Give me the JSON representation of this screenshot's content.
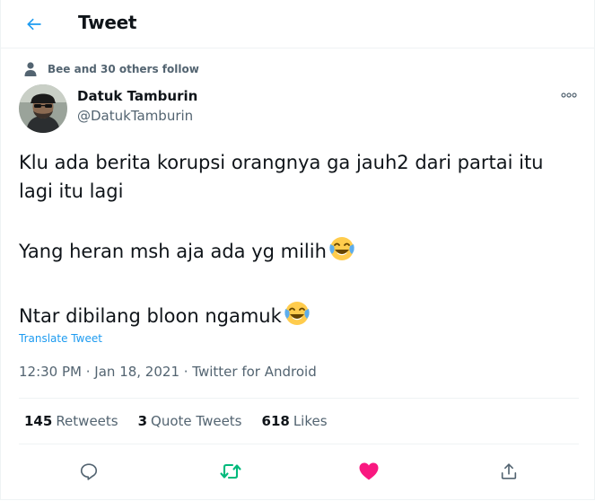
{
  "header": {
    "title": "Tweet"
  },
  "social_context": {
    "text": "Bee and 30 others follow"
  },
  "author": {
    "display_name": "Datuk Tamburin",
    "username": "@DatukTamburin"
  },
  "tweet": {
    "lines": [
      "Klu ada berita korupsi orangnya ga jauh2 dari partai itu lagi itu lagi",
      "Yang heran msh aja ada yg milih",
      "Ntar dibilang bloon ngamuk"
    ],
    "emoji": "face-with-tears-of-joy"
  },
  "translate_label": "Translate Tweet",
  "meta": {
    "time": "12:30 PM",
    "date": "Jan 18, 2021",
    "separator": " · ",
    "source": "Twitter for Android"
  },
  "stats": {
    "retweets": {
      "count": "145",
      "label": "Retweets"
    },
    "quotes": {
      "count": "3",
      "label": "Quote Tweets"
    },
    "likes": {
      "count": "618",
      "label": "Likes"
    }
  },
  "actions": [
    {
      "icon": "reply-icon",
      "state": "default"
    },
    {
      "icon": "retweet-icon",
      "state": "active"
    },
    {
      "icon": "like-icon",
      "state": "active"
    },
    {
      "icon": "share-icon",
      "state": "default"
    }
  ],
  "colors": {
    "accent": "#1d9bf0",
    "retweet_active": "#00ba7c",
    "like_active": "#f91880",
    "secondary_text": "#536471",
    "divider": "#eff3f4"
  }
}
